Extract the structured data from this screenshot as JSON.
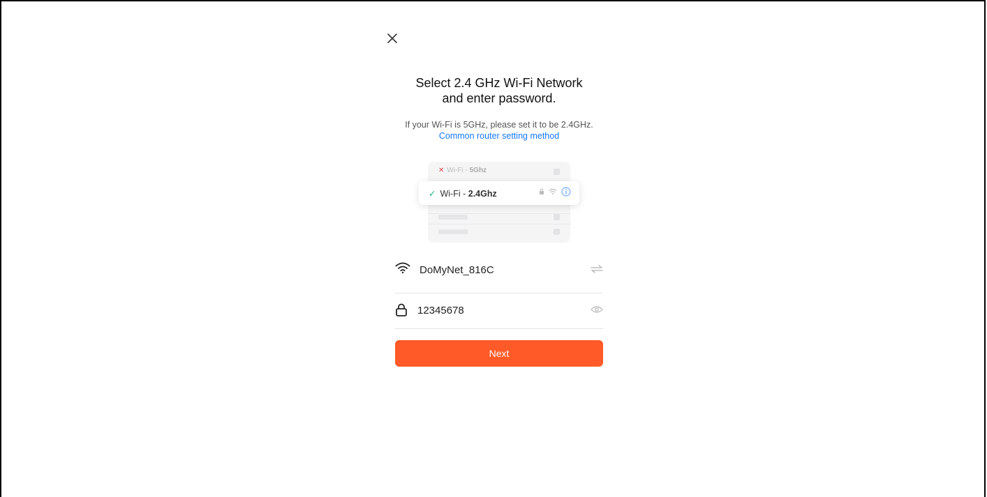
{
  "header": {
    "title_line1": "Select 2.4 GHz Wi-Fi Network",
    "title_line2": "and enter password.",
    "subtitle": "If your Wi-Fi is 5GHz, please set it to be 2.4GHz.",
    "help_link": "Common router setting method"
  },
  "illustration": {
    "bad_row_prefix": "Wi-Fi - ",
    "bad_row_band": "5Ghz",
    "good_row_prefix": "Wi-Fi - ",
    "good_row_band": "2.4Ghz"
  },
  "form": {
    "ssid_value": "DoMyNet_816C",
    "password_value": "12345678"
  },
  "actions": {
    "next_label": "Next"
  },
  "colors": {
    "accent": "#ff5a28",
    "link": "#1677ff",
    "check": "#14b37d",
    "error": "#e54444"
  }
}
